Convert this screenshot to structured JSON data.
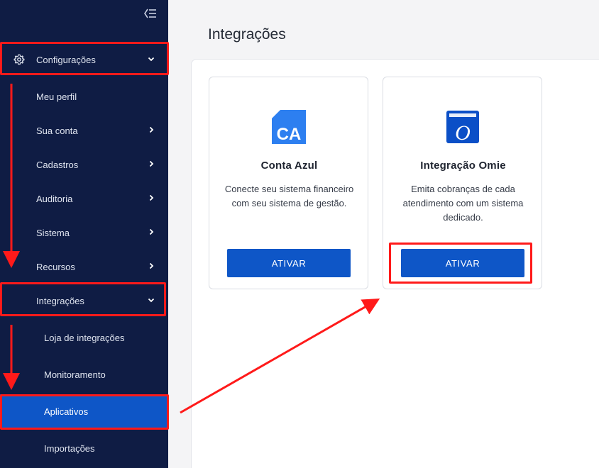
{
  "sidebar": {
    "items": [
      {
        "label": "Configurações",
        "icon": "gear-icon",
        "chevron": "down"
      },
      {
        "label": "Meu perfil"
      },
      {
        "label": "Sua conta",
        "chevron": "right"
      },
      {
        "label": "Cadastros",
        "chevron": "right"
      },
      {
        "label": "Auditoria",
        "chevron": "right"
      },
      {
        "label": "Sistema",
        "chevron": "right"
      },
      {
        "label": "Recursos",
        "chevron": "right"
      },
      {
        "label": "Integrações",
        "chevron": "down"
      },
      {
        "label": "Loja de integrações"
      },
      {
        "label": "Monitoramento"
      },
      {
        "label": "Aplicativos",
        "active": true
      },
      {
        "label": "Importações"
      }
    ]
  },
  "main": {
    "title": "Integrações",
    "cards": [
      {
        "logo_text": "CA",
        "name": "Conta Azul",
        "description": "Conecte seu sistema financeiro com seu sistema de gestão.",
        "button": "ATIVAR"
      },
      {
        "logo_text": "O",
        "name": "Integração Omie",
        "description": "Emita cobranças de cada atendimento com um sistema dedicado.",
        "button": "ATIVAR"
      }
    ]
  },
  "colors": {
    "sidebar_bg": "#0f1c44",
    "active_bg": "#0e56c7",
    "primary_button": "#0e56c7",
    "annotation_red": "#ff1a1a",
    "conta_azul_logo": "#2d7ff0",
    "omie_logo": "#0b4fc7"
  }
}
